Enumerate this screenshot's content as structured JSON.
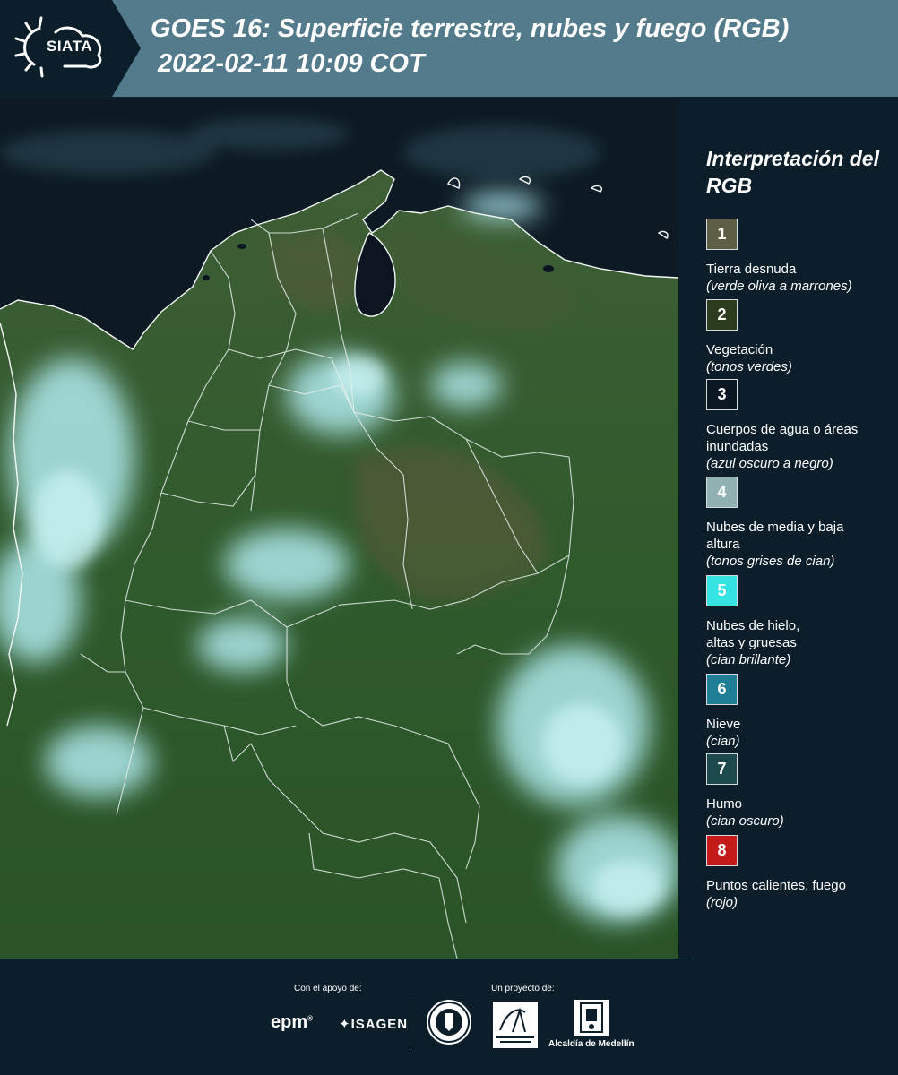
{
  "header": {
    "logo_text": "SIATA",
    "title_line1": "GOES 16: Superficie terrestre, nubes y fuego (RGB)",
    "title_line2": "2022-02-11 10:09 COT",
    "color": "#537b8c"
  },
  "legend": {
    "title": "Interpretación del RGB",
    "items": [
      {
        "num": "1",
        "label": "Tierra desnuda",
        "sub": "(verde oliva a marrones)",
        "color": "#5d5e44"
      },
      {
        "num": "2",
        "label": "Vegetación",
        "sub": "(tonos verdes)",
        "color": "#2c3c1e"
      },
      {
        "num": "3",
        "label": "Cuerpos de agua o áreas inundadas",
        "sub": "(azul oscuro a negro)",
        "color": "#0a1622"
      },
      {
        "num": "4",
        "label": "Nubes de media y baja altura",
        "sub": "(tonos grises de cian)",
        "color": "#8fb1b1"
      },
      {
        "num": "5",
        "label": "Nubes de hielo, altas y gruesas",
        "sub": "(cian brillante)",
        "color": "#35e3e3"
      },
      {
        "num": "6",
        "label": "Nieve",
        "sub": "(cian)",
        "color": "#1f7e96"
      },
      {
        "num": "7",
        "label": "Humo",
        "sub": "(cian oscuro)",
        "color": "#1c4a4c"
      },
      {
        "num": "8",
        "label": "Puntos calientes, fuego",
        "sub": "(rojo)",
        "color": "#c41a1a"
      }
    ]
  },
  "footer": {
    "support_caption": "Con el apoyo de:",
    "project_caption": "Un proyecto de:",
    "epm": "epm",
    "isagen": "ISAGEN",
    "medellin": "Alcaldía de Medellín"
  }
}
